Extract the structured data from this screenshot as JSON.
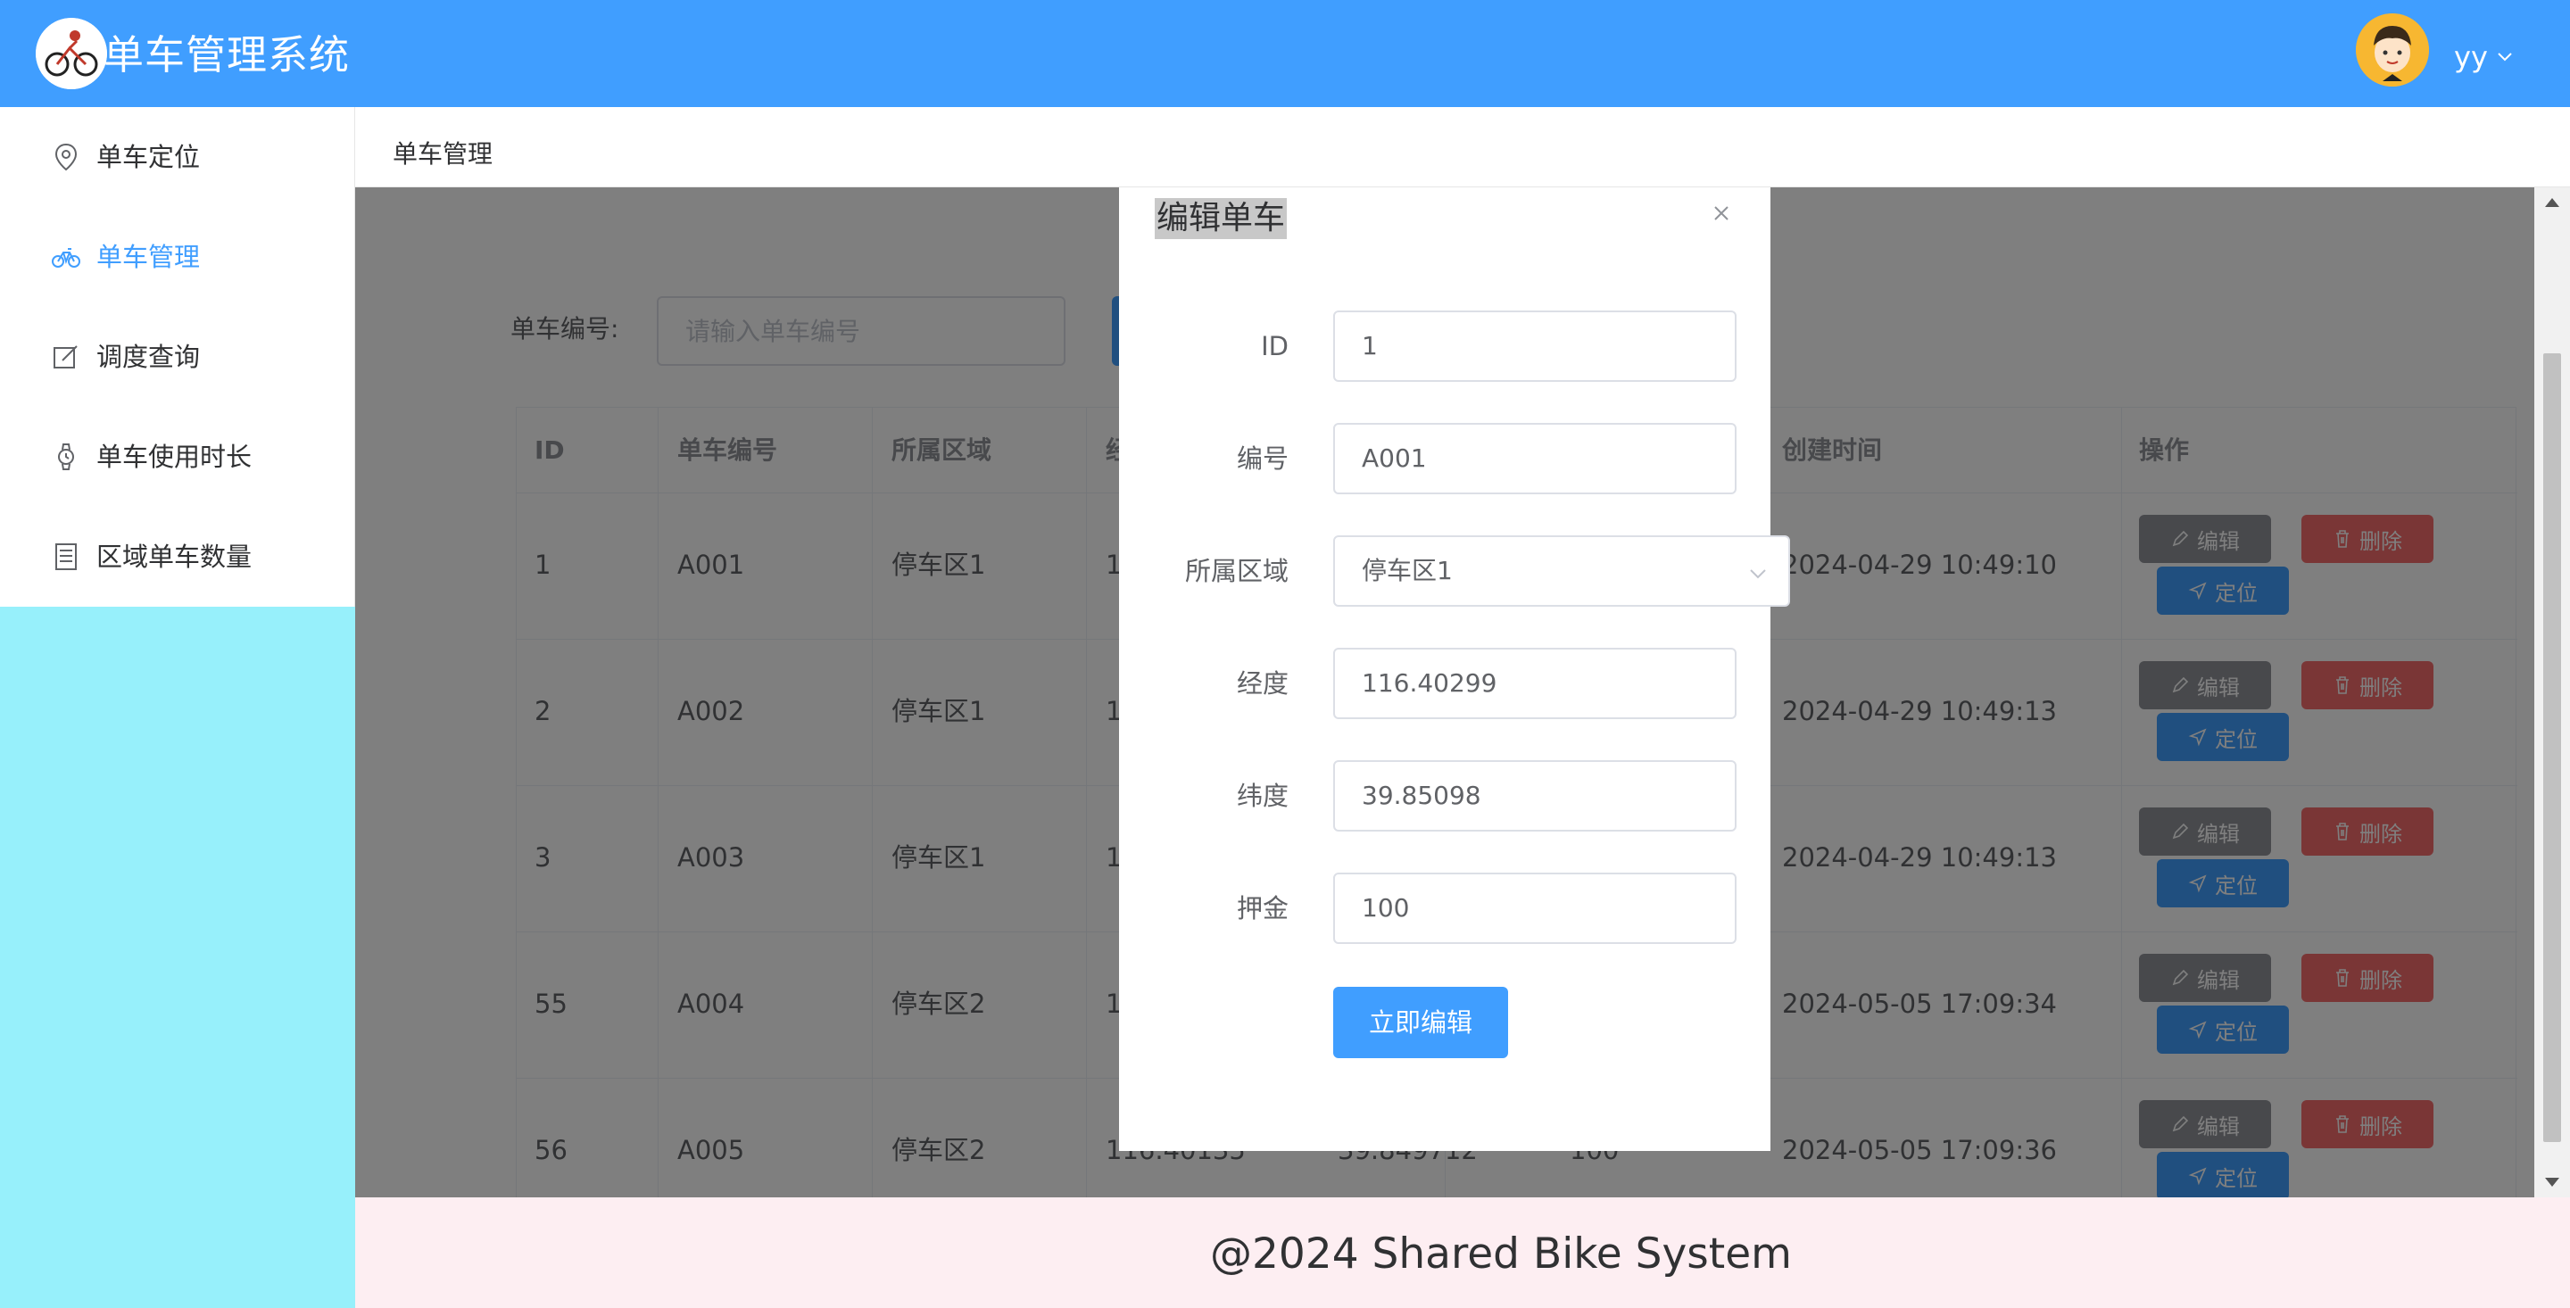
{
  "header": {
    "app_title": "单车管理系统",
    "user_name": "yy"
  },
  "sidebar": {
    "items": [
      {
        "label": "单车定位",
        "icon": "map-pin-icon",
        "active": false
      },
      {
        "label": "单车管理",
        "icon": "bicycle-icon",
        "active": true
      },
      {
        "label": "调度查询",
        "icon": "edit-icon",
        "active": false
      },
      {
        "label": "单车使用时长",
        "icon": "watch-icon",
        "active": false
      },
      {
        "label": "区域单车数量",
        "icon": "document-list-icon",
        "active": false
      }
    ]
  },
  "breadcrumb": "单车管理",
  "search": {
    "label": "单车编号:",
    "placeholder": "请输入单车编号"
  },
  "table": {
    "headers": [
      "ID",
      "单车编号",
      "所属区域",
      "经",
      "",
      "",
      "创建时间",
      "操作"
    ],
    "rows": [
      {
        "id": "1",
        "code": "A001",
        "area": "停车区1",
        "lng": "1",
        "lat": "",
        "deposit": "",
        "created": "2024-04-29 10:49:10"
      },
      {
        "id": "2",
        "code": "A002",
        "area": "停车区1",
        "lng": "1",
        "lat": "",
        "deposit": "",
        "created": "2024-04-29 10:49:13"
      },
      {
        "id": "3",
        "code": "A003",
        "area": "停车区1",
        "lng": "1",
        "lat": "",
        "deposit": "",
        "created": "2024-04-29 10:49:13"
      },
      {
        "id": "55",
        "code": "A004",
        "area": "停车区2",
        "lng": "1",
        "lat": "",
        "deposit": "",
        "created": "2024-05-05 17:09:34"
      },
      {
        "id": "56",
        "code": "A005",
        "area": "停车区2",
        "lng": "116.40135",
        "lat": "39.849712",
        "deposit": "100",
        "created": "2024-05-05 17:09:36"
      }
    ],
    "actions": {
      "edit": "编辑",
      "delete": "删除",
      "locate": "定位"
    }
  },
  "dialog": {
    "title": "编辑单车",
    "fields": [
      {
        "label": "ID",
        "value": "1"
      },
      {
        "label": "编号",
        "value": "A001"
      },
      {
        "label": "所属区域",
        "value": "停车区1"
      },
      {
        "label": "经度",
        "value": "116.40299"
      },
      {
        "label": "纬度",
        "value": "39.85098"
      },
      {
        "label": "押金",
        "value": "100"
      }
    ],
    "submit_label": "立即编辑"
  },
  "footer": "@2024 Shared Bike System",
  "colors": {
    "primary": "#409eff",
    "danger": "#f56c6c",
    "info": "#909399",
    "sidebar_bg": "#97f0fb",
    "footer_bg": "#fdeef2"
  }
}
